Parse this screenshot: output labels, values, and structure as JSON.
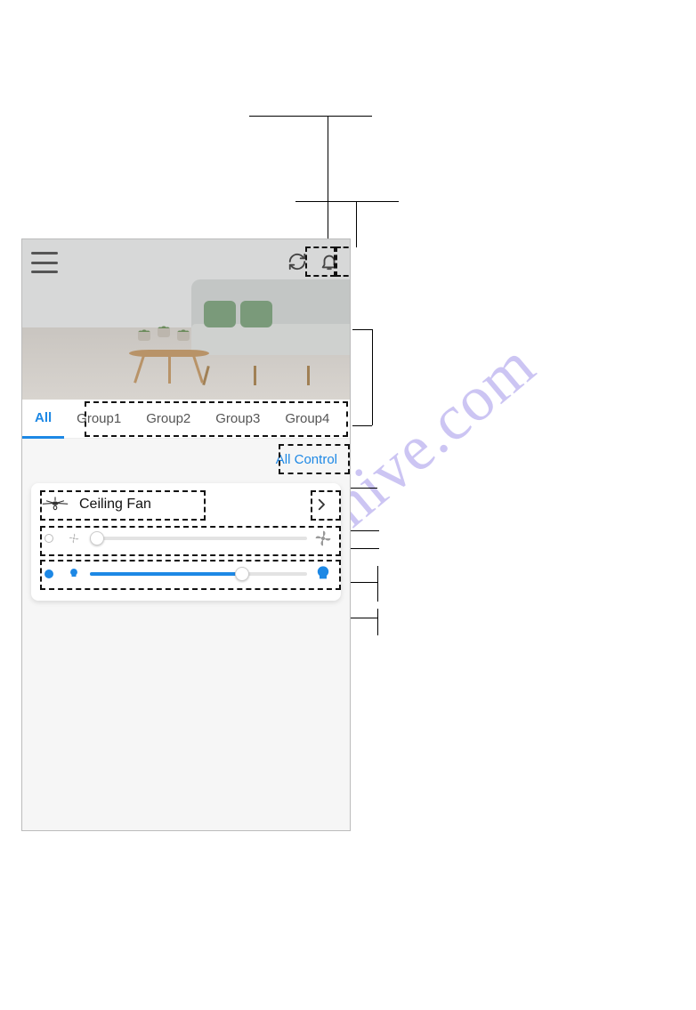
{
  "header": {
    "icons": {
      "menu": "hamburger-icon",
      "refresh": "refresh-icon",
      "notifications": "bell-icon"
    }
  },
  "tabs": [
    {
      "label": "All",
      "active": true
    },
    {
      "label": "Group1",
      "active": false
    },
    {
      "label": "Group2",
      "active": false
    },
    {
      "label": "Group3",
      "active": false
    },
    {
      "label": "Group4",
      "active": false
    }
  ],
  "controlbar": {
    "all_control_label": "All Control"
  },
  "device": {
    "name": "Ceiling Fan",
    "icon": "ceiling-fan-icon",
    "chevron": "chevron-right-icon",
    "fan_slider": {
      "power": "off",
      "value_pct": 0,
      "lead_icon": "power-ring-icon",
      "lead2_icon": "fan-small-icon",
      "trail_icon": "fan-large-icon"
    },
    "light_slider": {
      "power": "on",
      "value_pct": 70,
      "lead_icon": "power-dot-icon",
      "lead2_icon": "bulb-small-icon",
      "trail_icon": "bulb-large-icon"
    }
  },
  "colors": {
    "accent": "#1d88e5",
    "text": "#111111",
    "muted": "#555555",
    "divider": "#eeeeee",
    "track_bg": "#e3e3e3"
  },
  "watermark": "manualshive.com"
}
